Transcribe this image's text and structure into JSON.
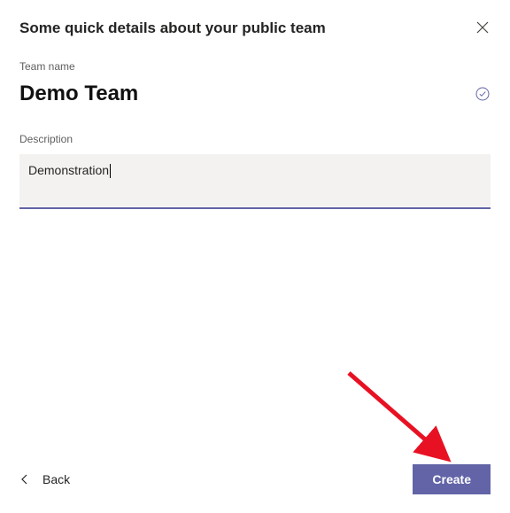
{
  "dialog": {
    "title": "Some quick details about your public team",
    "team_name_label": "Team name",
    "team_name_value": "Demo Team",
    "description_label": "Description",
    "description_value": "Demonstration",
    "back_label": "Back",
    "create_label": "Create"
  },
  "icons": {
    "close": "close-icon",
    "check": "check-circle-icon",
    "chevron_left": "chevron-left-icon",
    "annotation_arrow": "annotation-arrow"
  },
  "colors": {
    "accent": "#6264a7",
    "field_bg": "#f3f2f1",
    "text_secondary": "#605e5c",
    "arrow": "#e81123"
  }
}
